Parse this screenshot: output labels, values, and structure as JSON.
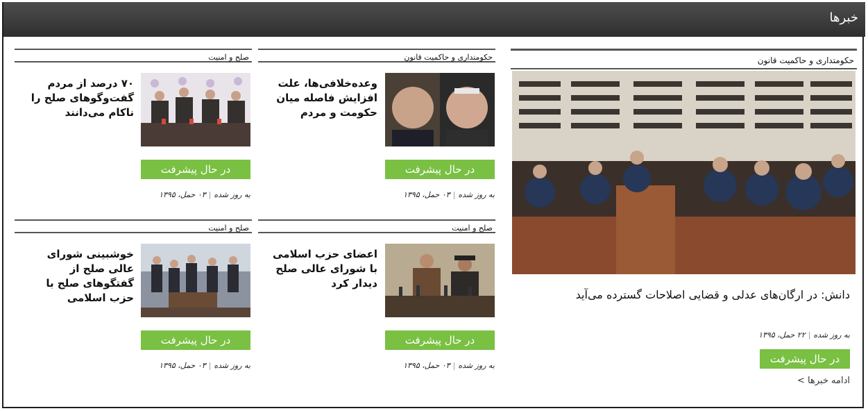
{
  "header": {
    "title": "خبرها"
  },
  "featured": {
    "category": "حکومتداری و حاکمیت قانون",
    "headline": "دانش: در ارگان‌های عدلی و قضایی اصلاحات گسترده می‌آید",
    "date_prefix": "به روز شده",
    "date": "۲۲ حمل، ۱۳۹۵",
    "button": "در حال پیشرفت",
    "more_link": "ادامه خبرها >"
  },
  "cards": [
    {
      "category": "حکومتداری و حاکمیت قانون",
      "headline": "وعده‌خلافی‌ها، علت افزایش فاصله میان حکومت و مردم",
      "button": "در حال پیشرفت",
      "date_prefix": "به روز شده",
      "date": "۰۳ حمل، ۱۳۹۵"
    },
    {
      "category": "صلح و امنیت",
      "headline": "۷۰ درصد از مردم گفت‌وگوهای صلح را ناکام می‌دانند",
      "button": "در حال پیشرفت",
      "date_prefix": "به روز شده",
      "date": "۰۳ حمل، ۱۳۹۵"
    },
    {
      "category": "صلح و امنیت",
      "headline": "اعضای حزب اسلامی با شورای عالی صلح دیدار کرد",
      "button": "در حال پیشرفت",
      "date_prefix": "به روز شده",
      "date": "۰۳ حمل، ۱۳۹۵"
    },
    {
      "category": "صلح و امنیت",
      "headline": "خوشبینی شورای عالی صلح از گفتگوهای صلح با حزب اسلامی",
      "button": "در حال پیشرفت",
      "date_prefix": "به روز شده",
      "date": "۰۳ حمل، ۱۳۹۵"
    }
  ],
  "colors": {
    "accent": "#79c043",
    "header_bg": "#3a3a3a"
  }
}
